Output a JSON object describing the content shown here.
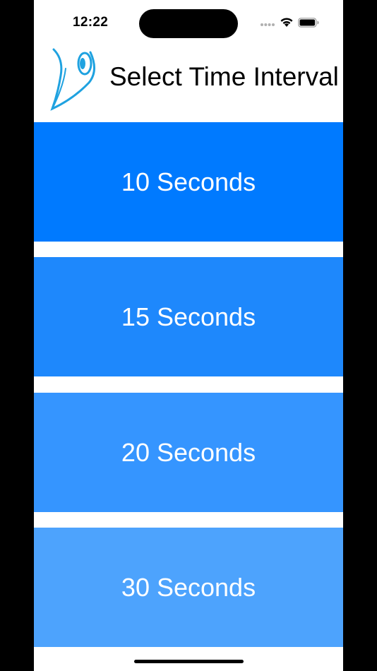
{
  "status_bar": {
    "time": "12:22",
    "icons": [
      "cellular-dots-icon",
      "wifi-icon",
      "battery-icon"
    ]
  },
  "header": {
    "logo_icon": "speech-bubble-logo",
    "title": "Select Time Interval"
  },
  "options": [
    {
      "label": "10 Seconds",
      "color": "#007aff"
    },
    {
      "label": "15 Seconds",
      "color": "#1e88fc"
    },
    {
      "label": "20 Seconds",
      "color": "#3595ff"
    },
    {
      "label": "30 Seconds",
      "color": "#4da3fd"
    }
  ],
  "colors": {
    "logo_blue": "#1fa2e0",
    "background": "#ffffff"
  }
}
